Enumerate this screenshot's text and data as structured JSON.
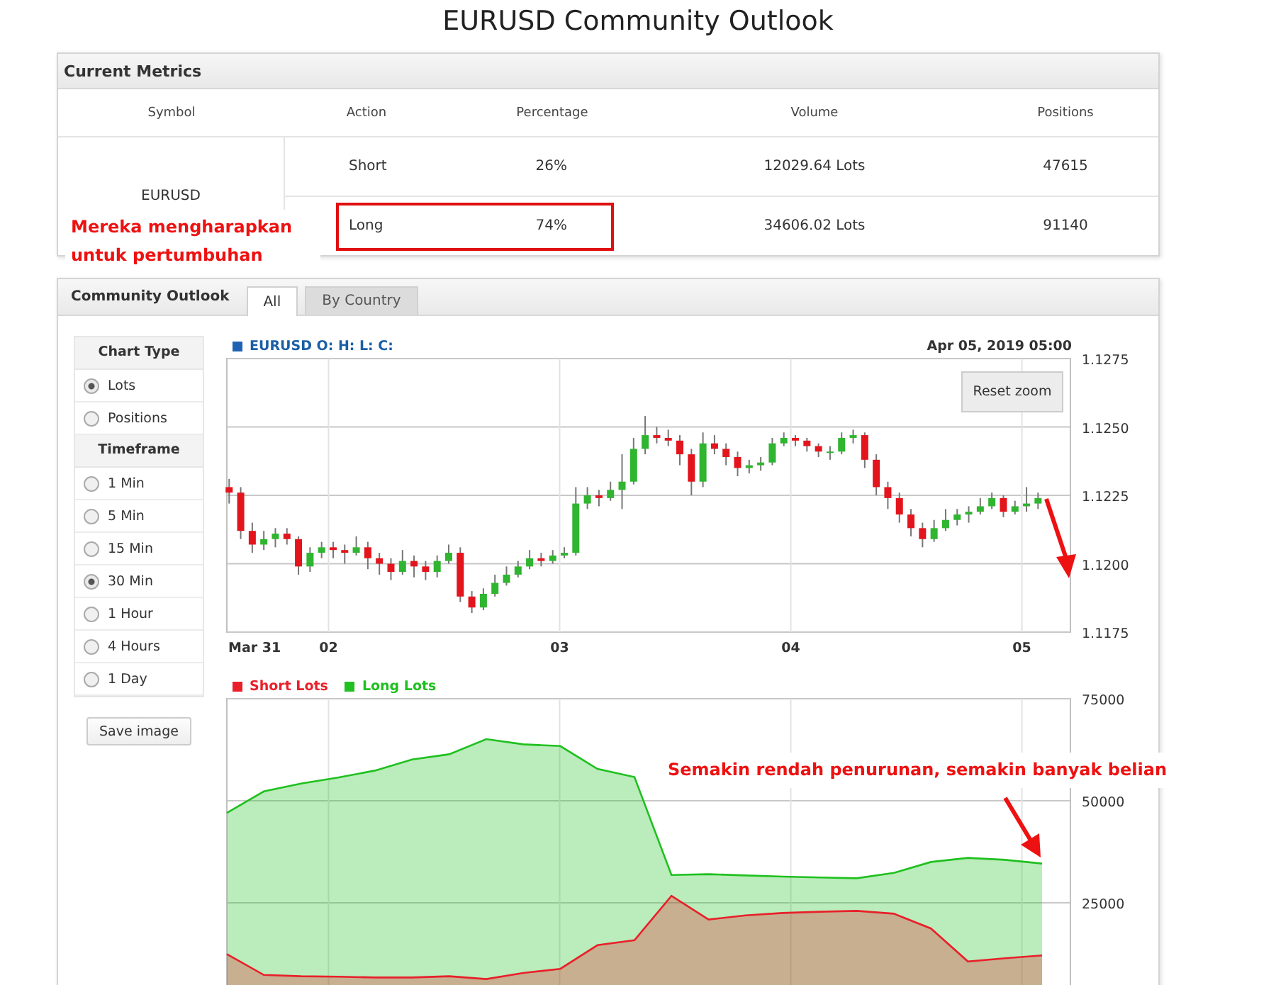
{
  "page_title": "EURUSD Community Outlook",
  "metrics": {
    "title": "Current Metrics",
    "columns": [
      "Symbol",
      "Action",
      "Percentage",
      "Volume",
      "Positions"
    ],
    "symbol": "EURUSD",
    "rows": [
      {
        "action": "Short",
        "percentage": "26%",
        "volume": "12029.64 Lots",
        "positions": "47615",
        "highlighted": false
      },
      {
        "action": "Long",
        "percentage": "74%",
        "volume": "34606.02 Lots",
        "positions": "91140",
        "highlighted": true
      }
    ],
    "note": "Mereka mengharapkan untuk pertumbuhan"
  },
  "outlook": {
    "title": "Community Outlook",
    "tabs": [
      {
        "label": "All",
        "selected": true
      },
      {
        "label": "By Country",
        "selected": false
      }
    ],
    "chart_type": {
      "heading": "Chart Type",
      "options": [
        {
          "label": "Lots",
          "selected": true
        },
        {
          "label": "Positions",
          "selected": false
        }
      ]
    },
    "timeframe": {
      "heading": "Timeframe",
      "options": [
        {
          "label": "1 Min",
          "selected": false
        },
        {
          "label": "5 Min",
          "selected": false
        },
        {
          "label": "15 Min",
          "selected": false
        },
        {
          "label": "30 Min",
          "selected": true
        },
        {
          "label": "1 Hour",
          "selected": false
        },
        {
          "label": "4 Hours",
          "selected": false
        },
        {
          "label": "1 Day",
          "selected": false
        }
      ]
    },
    "save_button": "Save image",
    "price_chart": {
      "legend": "EURUSD O: H: L: C:",
      "timestamp": "Apr 05, 2019 05:00",
      "reset_button": "Reset zoom",
      "chart_data": {
        "type": "candlestick",
        "x": [
          1.57,
          1.62,
          1.67,
          1.72,
          1.77,
          1.82,
          1.87,
          1.92,
          1.97,
          2.02,
          2.07,
          2.12,
          2.17,
          2.22,
          2.27,
          2.32,
          2.37,
          2.42,
          2.47,
          2.52,
          2.57,
          2.62,
          2.67,
          2.72,
          2.77,
          2.82,
          2.87,
          2.92,
          2.97,
          3.02,
          3.07,
          3.12,
          3.17,
          3.22,
          3.27,
          3.32,
          3.37,
          3.42,
          3.47,
          3.52,
          3.57,
          3.62,
          3.67,
          3.72,
          3.77,
          3.82,
          3.87,
          3.92,
          3.97,
          4.02,
          4.07,
          4.12,
          4.17,
          4.22,
          4.27,
          4.32,
          4.37,
          4.42,
          4.47,
          4.52,
          4.57,
          4.62,
          4.67,
          4.72,
          4.77,
          4.82,
          4.87,
          4.92,
          4.97,
          5.02,
          5.07
        ],
        "ohlc": [
          [
            1.1228,
            1.1231,
            1.1222,
            1.1226
          ],
          [
            1.1226,
            1.1228,
            1.1209,
            1.1212
          ],
          [
            1.1212,
            1.1215,
            1.1204,
            1.1207
          ],
          [
            1.1207,
            1.1212,
            1.1205,
            1.1209
          ],
          [
            1.1209,
            1.1213,
            1.1206,
            1.1211
          ],
          [
            1.1211,
            1.1213,
            1.1207,
            1.1209
          ],
          [
            1.1209,
            1.121,
            1.1196,
            1.1199
          ],
          [
            1.1199,
            1.1206,
            1.1197,
            1.1204
          ],
          [
            1.1204,
            1.1208,
            1.1202,
            1.1206
          ],
          [
            1.1206,
            1.1208,
            1.1202,
            1.1205
          ],
          [
            1.1205,
            1.1207,
            1.12,
            1.1204
          ],
          [
            1.1204,
            1.121,
            1.1203,
            1.1206
          ],
          [
            1.1206,
            1.1208,
            1.1198,
            1.1202
          ],
          [
            1.1202,
            1.1204,
            1.1196,
            1.12
          ],
          [
            1.12,
            1.1202,
            1.1194,
            1.1197
          ],
          [
            1.1197,
            1.1205,
            1.1196,
            1.1201
          ],
          [
            1.1201,
            1.1203,
            1.1195,
            1.1199
          ],
          [
            1.1199,
            1.1201,
            1.1194,
            1.1197
          ],
          [
            1.1197,
            1.1203,
            1.1195,
            1.1201
          ],
          [
            1.1201,
            1.1207,
            1.12,
            1.1204
          ],
          [
            1.1204,
            1.1206,
            1.1186,
            1.1188
          ],
          [
            1.1188,
            1.119,
            1.1182,
            1.1184
          ],
          [
            1.1184,
            1.1191,
            1.1183,
            1.1189
          ],
          [
            1.1189,
            1.1196,
            1.1188,
            1.1193
          ],
          [
            1.1193,
            1.1199,
            1.1192,
            1.1196
          ],
          [
            1.1196,
            1.1201,
            1.1195,
            1.1199
          ],
          [
            1.1199,
            1.1205,
            1.1198,
            1.1202
          ],
          [
            1.1202,
            1.1204,
            1.1199,
            1.1201
          ],
          [
            1.1201,
            1.1205,
            1.12,
            1.1203
          ],
          [
            1.1203,
            1.1206,
            1.1202,
            1.1204
          ],
          [
            1.1204,
            1.1228,
            1.1203,
            1.1222
          ],
          [
            1.1222,
            1.1228,
            1.122,
            1.1225
          ],
          [
            1.1225,
            1.1227,
            1.1221,
            1.1224
          ],
          [
            1.1224,
            1.123,
            1.1223,
            1.1227
          ],
          [
            1.1227,
            1.124,
            1.122,
            1.123
          ],
          [
            1.123,
            1.1246,
            1.1229,
            1.1242
          ],
          [
            1.1242,
            1.1254,
            1.124,
            1.1247
          ],
          [
            1.1247,
            1.125,
            1.1244,
            1.1246
          ],
          [
            1.1246,
            1.1249,
            1.1243,
            1.1245
          ],
          [
            1.1245,
            1.1247,
            1.1236,
            1.124
          ],
          [
            1.124,
            1.1242,
            1.1225,
            1.123
          ],
          [
            1.123,
            1.1248,
            1.1228,
            1.1244
          ],
          [
            1.1244,
            1.1247,
            1.124,
            1.1242
          ],
          [
            1.1242,
            1.1244,
            1.1236,
            1.1239
          ],
          [
            1.1239,
            1.1241,
            1.1232,
            1.1235
          ],
          [
            1.1235,
            1.1238,
            1.1233,
            1.1236
          ],
          [
            1.1236,
            1.1239,
            1.1234,
            1.1237
          ],
          [
            1.1237,
            1.1246,
            1.1236,
            1.1244
          ],
          [
            1.1244,
            1.1248,
            1.1243,
            1.1246
          ],
          [
            1.1246,
            1.1247,
            1.1243,
            1.1245
          ],
          [
            1.1245,
            1.1246,
            1.1241,
            1.1243
          ],
          [
            1.1243,
            1.1244,
            1.1239,
            1.1241
          ],
          [
            1.1241,
            1.1243,
            1.1238,
            1.1241
          ],
          [
            1.1241,
            1.1248,
            1.124,
            1.1246
          ],
          [
            1.1246,
            1.1249,
            1.1244,
            1.1247
          ],
          [
            1.1247,
            1.1248,
            1.1235,
            1.1238
          ],
          [
            1.1238,
            1.124,
            1.1225,
            1.1228
          ],
          [
            1.1228,
            1.123,
            1.122,
            1.1224
          ],
          [
            1.1224,
            1.1226,
            1.1215,
            1.1218
          ],
          [
            1.1218,
            1.122,
            1.121,
            1.1213
          ],
          [
            1.1213,
            1.1215,
            1.1206,
            1.1209
          ],
          [
            1.1209,
            1.1216,
            1.1208,
            1.1213
          ],
          [
            1.1213,
            1.122,
            1.1212,
            1.1216
          ],
          [
            1.1216,
            1.122,
            1.1214,
            1.1218
          ],
          [
            1.1218,
            1.1221,
            1.1215,
            1.1219
          ],
          [
            1.1219,
            1.1224,
            1.1218,
            1.1221
          ],
          [
            1.1221,
            1.1226,
            1.122,
            1.1224
          ],
          [
            1.1224,
            1.1225,
            1.1217,
            1.1219
          ],
          [
            1.1219,
            1.1223,
            1.1218,
            1.1221
          ],
          [
            1.1221,
            1.1228,
            1.1219,
            1.1222
          ],
          [
            1.1222,
            1.1226,
            1.122,
            1.1224
          ]
        ],
        "xlim": [
          1.56,
          5.21
        ],
        "ylim": [
          1.1175,
          1.1275
        ],
        "xticks": [
          {
            "value": 1.68,
            "label": "Mar 31"
          },
          {
            "value": 2,
            "label": "02"
          },
          {
            "value": 3,
            "label": "03"
          },
          {
            "value": 4,
            "label": "04"
          },
          {
            "value": 5,
            "label": "05"
          }
        ],
        "yticks": [
          {
            "value": 1.1275,
            "label": "1.1275"
          },
          {
            "value": 1.125,
            "label": "1.1250"
          },
          {
            "value": 1.1225,
            "label": "1.1225"
          },
          {
            "value": 1.12,
            "label": "1.1200"
          },
          {
            "value": 1.1175,
            "label": "1.1175"
          }
        ],
        "grid": true
      }
    },
    "lots_chart": {
      "chart_data": {
        "type": "area",
        "categories": [
          null,
          null,
          null,
          null,
          null,
          null,
          null,
          null,
          null,
          null,
          null,
          null,
          null,
          null,
          null,
          null,
          null,
          null,
          null,
          null,
          null,
          null,
          null
        ],
        "series": [
          {
            "name": "Short Lots",
            "color": "#e8202a",
            "values": [
              12400,
              7300,
              7000,
              6900,
              6700,
              6700,
              7000,
              6300,
              7800,
              8800,
              14600,
              15800,
              26700,
              20900,
              21900,
              22500,
              22800,
              23000,
              22300,
              18700,
              10600,
              11400,
              12100
            ]
          },
          {
            "name": "Long Lots",
            "color": "#1fc01f",
            "values": [
              47000,
              52300,
              54200,
              55700,
              57400,
              60100,
              61400,
              65100,
              63800,
              63400,
              57800,
              55800,
              31800,
              32000,
              31700,
              31400,
              31200,
              31000,
              32300,
              35000,
              36000,
              35500,
              34600
            ]
          }
        ],
        "ylim": [
          3800,
          75000
        ],
        "yticks": [
          {
            "value": 25000,
            "label": "25000"
          },
          {
            "value": 50000,
            "label": "50000"
          },
          {
            "value": 75000,
            "label": "75000"
          }
        ],
        "stacked": false,
        "grid": true
      }
    },
    "note": "Semakin rendah penurunan, semakin banyak belian"
  }
}
